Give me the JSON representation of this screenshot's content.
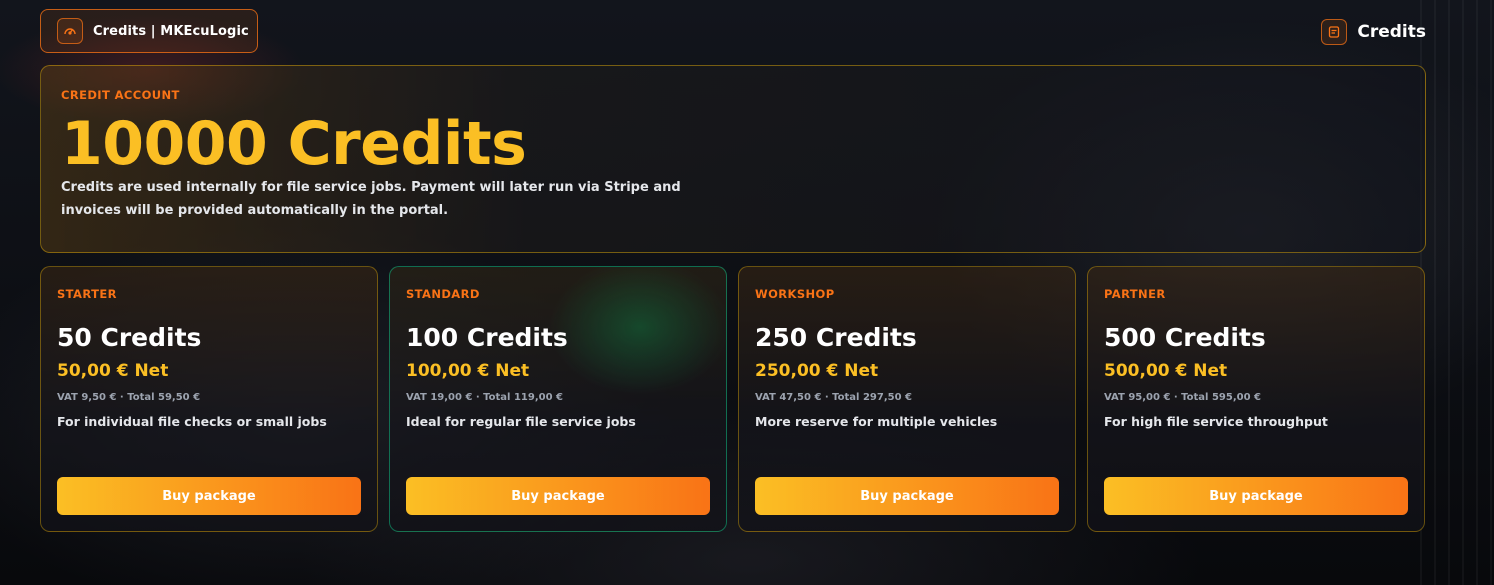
{
  "header": {
    "brand_label": "Credits | MKEcuLogic",
    "brand_icon": "gauge-icon",
    "page_label": "Credits",
    "page_icon": "document-icon",
    "accent_color": "#f97316"
  },
  "account": {
    "label": "CREDIT ACCOUNT",
    "total": "10000 Credits",
    "description": "Credits are used internally for file service jobs. Payment will later run via Stripe and invoices will be provided automatically in the portal."
  },
  "packages": [
    {
      "tier": "STARTER",
      "credits": "50 Credits",
      "price": "50,00 € Net",
      "vat": "VAT 9,50 € · Total 59,50 €",
      "description": "For individual file checks or small jobs",
      "button": "Buy package"
    },
    {
      "tier": "STANDARD",
      "credits": "100 Credits",
      "price": "100,00 € Net",
      "vat": "VAT 19,00 € · Total 119,00 €",
      "description": "Ideal for regular file service jobs",
      "button": "Buy package",
      "highlighted": true
    },
    {
      "tier": "WORKSHOP",
      "credits": "250 Credits",
      "price": "250,00 € Net",
      "vat": "VAT 47,50 € · Total 297,50 €",
      "description": "More reserve for multiple vehicles",
      "button": "Buy package"
    },
    {
      "tier": "PARTNER",
      "credits": "500 Credits",
      "price": "500,00 € Net",
      "vat": "VAT 95,00 € · Total 595,00 €",
      "description": "For high file service throughput",
      "button": "Buy package"
    }
  ]
}
